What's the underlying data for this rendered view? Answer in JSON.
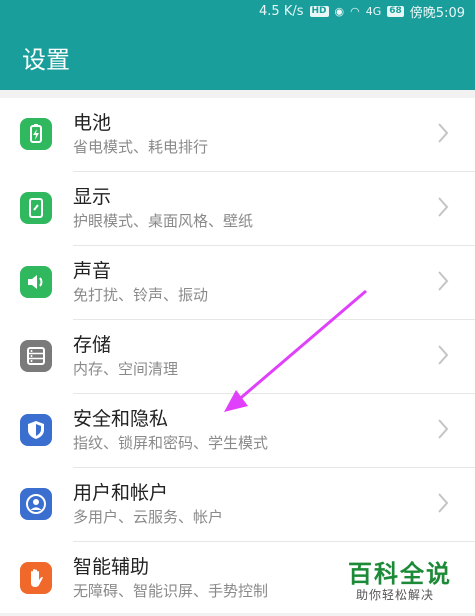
{
  "status_bar": {
    "net_speed": "4.5 K/s",
    "hd_badge": "HD",
    "signal_label": "4G",
    "battery": "68",
    "time": "傍晚5:09"
  },
  "header": {
    "title": "设置"
  },
  "items": [
    {
      "label": "电池",
      "sub": "省电模式、耗电排行",
      "icon": "battery-icon",
      "color": "#2fb85d"
    },
    {
      "label": "显示",
      "sub": "护眼模式、桌面风格、壁纸",
      "icon": "display-icon",
      "color": "#2fb85d"
    },
    {
      "label": "声音",
      "sub": "免打扰、铃声、振动",
      "icon": "sound-icon",
      "color": "#2fb85d"
    },
    {
      "label": "存储",
      "sub": "内存、空间清理",
      "icon": "storage-icon",
      "color": "#7a7a7a"
    },
    {
      "label": "安全和隐私",
      "sub": "指纹、锁屏和密码、学生模式",
      "icon": "shield-icon",
      "color": "#3a6fd0"
    },
    {
      "label": "用户和帐户",
      "sub": "多用户、云服务、帐户",
      "icon": "user-icon",
      "color": "#3a6fd0"
    },
    {
      "label": "智能辅助",
      "sub": "无障碍、智能识屏、手势控制",
      "icon": "hand-icon",
      "color": "#f0692b"
    }
  ],
  "watermark": {
    "title": "百科全说",
    "subtitle": "助你轻松解决"
  },
  "annotation": {
    "arrow_color": "#e040fb"
  }
}
